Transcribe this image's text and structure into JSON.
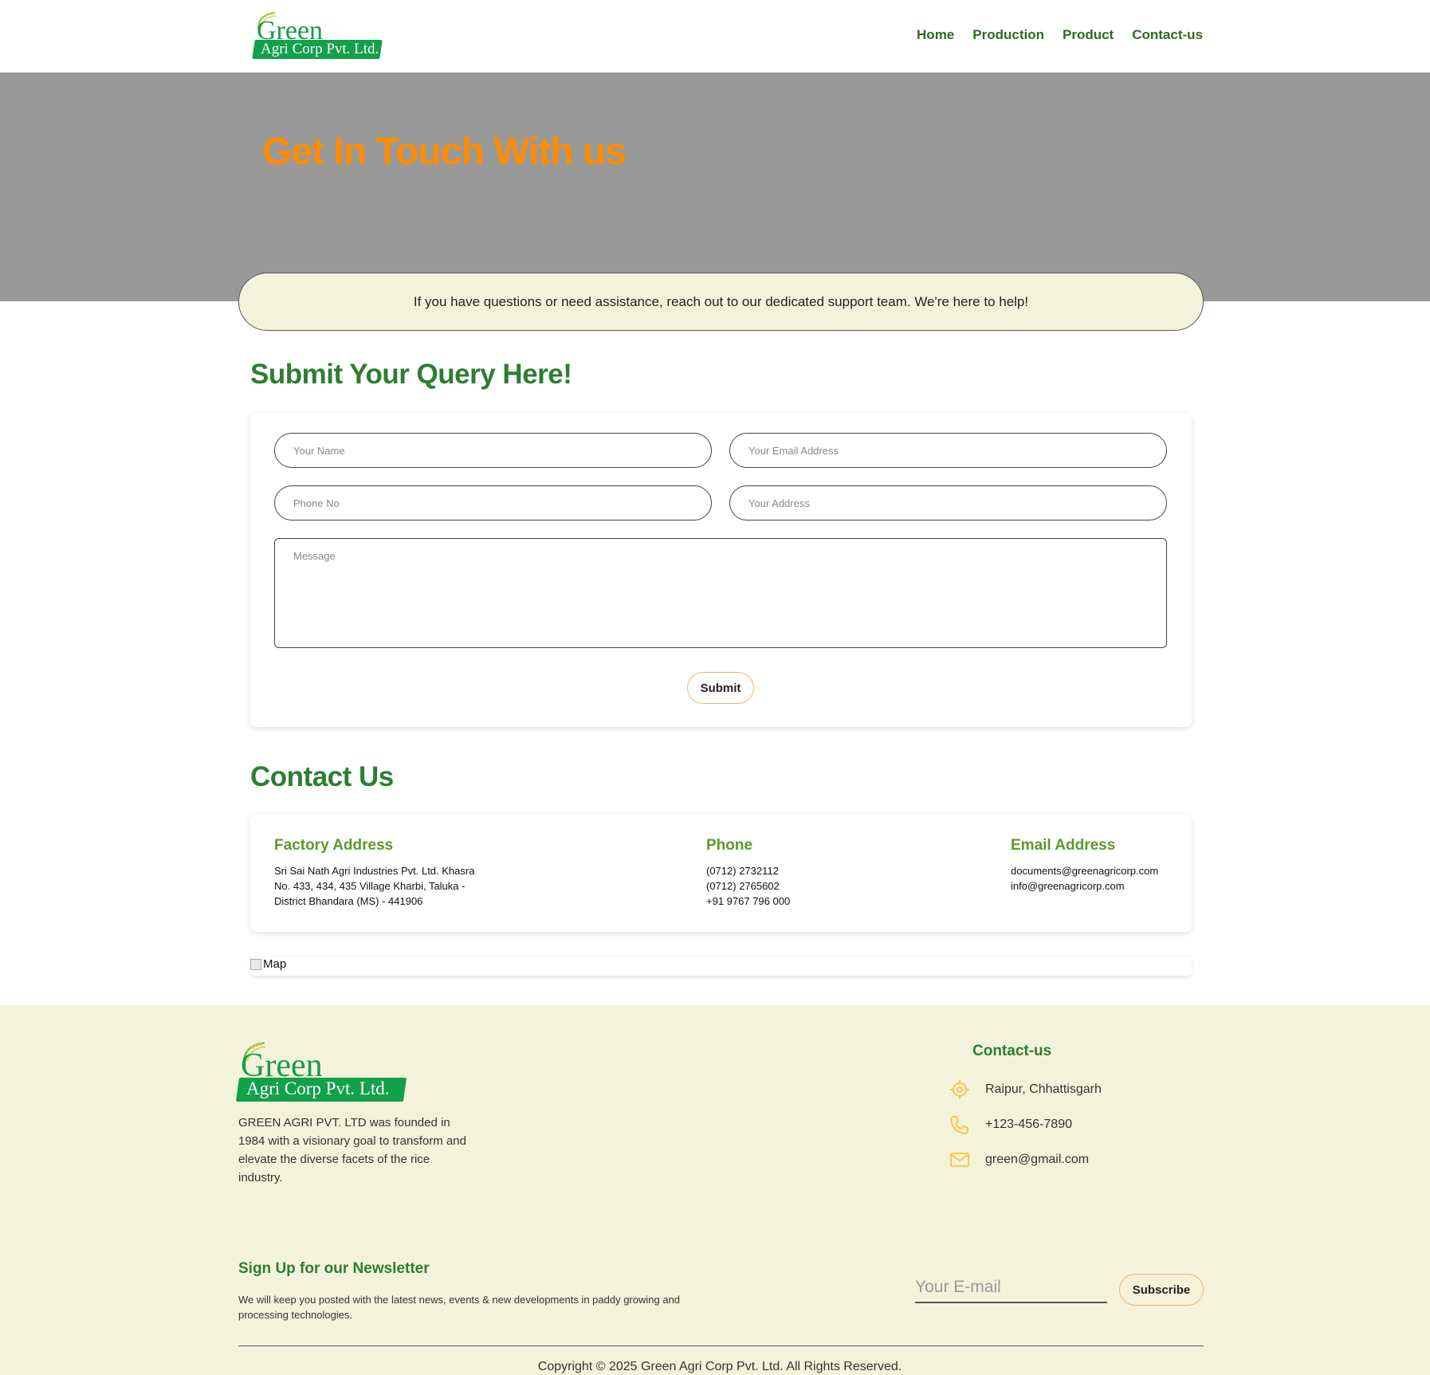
{
  "nav": {
    "logo": {
      "title": "Green",
      "subtitle": "Agri Corp Pvt. Ltd."
    },
    "links": [
      "Home",
      "Production",
      "Product",
      "Contact-us"
    ]
  },
  "hero": {
    "title": "Get In Touch With us",
    "banner": "If you have questions or need assistance, reach out to our dedicated support team. We're here to help!"
  },
  "query": {
    "heading": "Submit Your Query Here!",
    "name_placeholder": "Your Name",
    "email_placeholder": "Your Email Address",
    "phone_placeholder": "Phone No",
    "address_placeholder": "Your Address",
    "message_placeholder": "Message",
    "submit_label": "Submit"
  },
  "contact": {
    "heading": "Contact Us",
    "factory": {
      "title": "Factory Address",
      "lines": [
        "Sri Sai Nath Agri Industries Pvt. Ltd. Khasra",
        "No. 433, 434, 435 Village Kharbi, Taluka -",
        "District Bhandara (MS) - 441906"
      ]
    },
    "phone": {
      "title": "Phone",
      "lines": [
        "(0712) 2732112",
        "(0712) 2765602",
        "+91 9767 796 000"
      ]
    },
    "email": {
      "title": "Email Address",
      "lines": [
        "documents@greenagricorp.com",
        "info@greenagricorp.com"
      ]
    },
    "map_alt": "Map"
  },
  "footer": {
    "logo": {
      "title": "Green",
      "subtitle": "Agri Corp Pvt. Ltd."
    },
    "about": "GREEN AGRI PVT. LTD was founded in 1984 with a visionary goal to transform and elevate the diverse facets of the rice industry.",
    "contact_title": "Contact-us",
    "location": "Raipur, Chhattisgarh",
    "phone": "+123-456-7890",
    "email": "green@gmail.com",
    "newsletter_title": "Sign Up for our Newsletter",
    "newsletter_text": "We will keep you posted with the latest news, events & new developments in paddy growing and processing technologies.",
    "email_placeholder": "Your E-mail",
    "subscribe_label": "Subscribe",
    "copyright": "Copyright © 2025 Green Agri Corp Pvt. Ltd. All Rights Reserved.",
    "icon_color": "#f5c842"
  },
  "colors": {
    "brand_green": "#2e7d32",
    "accent_orange": "#ff8c00",
    "cream": "#f3f3dc"
  },
  "icons": [
    "leaf-icon",
    "location-icon",
    "phone-icon",
    "mail-icon",
    "broken-image-icon"
  ]
}
